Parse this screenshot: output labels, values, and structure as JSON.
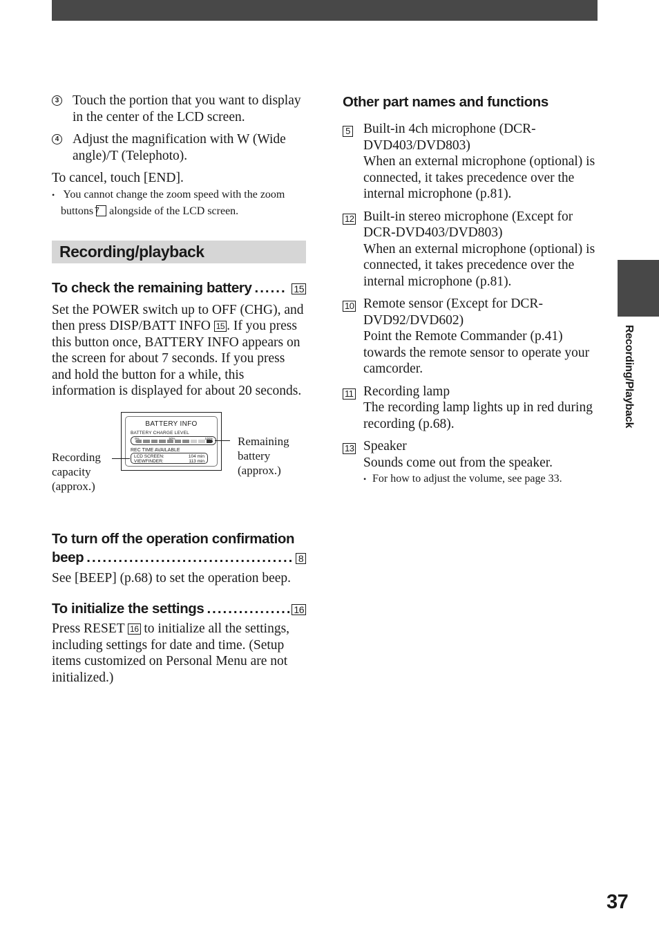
{
  "header": {
    "bar_color": "#484848"
  },
  "left": {
    "steps": [
      {
        "num": "3",
        "text": "Touch the portion that you want to display in the center of the LCD screen."
      },
      {
        "num": "4",
        "text": "Adjust the magnification with W (Wide angle)/T (Telephoto)."
      }
    ],
    "cancel_text": "To cancel, touch [END].",
    "note": {
      "before": "You cannot change the zoom speed with the zoom buttons",
      "ref": "7",
      "after": "alongside of the LCD screen."
    },
    "section_title": "Recording/playback",
    "battery": {
      "heading": "To check the remaining battery",
      "ref": "15",
      "body_1": "Set the POWER switch up to OFF (CHG), and then press DISP/BATT INFO",
      "body_ref": "15",
      "body_2": ". If you press this button once, BATTERY INFO appears on the screen for about 7 seconds. If you press and hold the button for a while, this information is displayed for about 20 seconds."
    },
    "diagram": {
      "title": "BATTERY INFO",
      "charge_label": "BATTERY CHARGE LEVEL",
      "ticks": [
        "0%",
        "50%",
        "100%"
      ],
      "charge_level": 0.7,
      "rec_label": "REC TIME AVAILABLE",
      "rows": [
        {
          "label": "LCD SCREEN:",
          "value": "104 min"
        },
        {
          "label": "VIEWFINDER:",
          "value": "113 min"
        }
      ],
      "callout_left": [
        "Recording",
        "capacity",
        "(approx.)"
      ],
      "callout_right": [
        "Remaining",
        "battery",
        "(approx.)"
      ]
    },
    "beep": {
      "heading_line1": "To turn off the operation confirmation",
      "heading_line2": "beep",
      "ref": "8",
      "body": "See [BEEP] (p.68) to set the operation beep."
    },
    "init": {
      "heading": "To initialize the settings",
      "ref": "16",
      "body_1": "Press RESET",
      "body_ref": "16",
      "body_2": "to initialize all the settings, including settings for date and time. (Setup items customized on Personal Menu are not initialized.)"
    }
  },
  "right": {
    "heading": "Other part names and functions",
    "items": [
      {
        "ref": "5",
        "title": "Built-in 4ch microphone (DCR-DVD403/DVD803)",
        "desc": "When an external microphone (optional) is connected, it takes precedence over the internal microphone (p.81)."
      },
      {
        "ref": "12",
        "title": "Built-in stereo microphone (Except for DCR-DVD403/DVD803)",
        "desc": "When an external microphone (optional) is connected, it takes precedence over the internal microphone (p.81)."
      },
      {
        "ref": "10",
        "title": "Remote sensor (Except for DCR-DVD92/DVD602)",
        "desc": "Point the Remote Commander (p.41) towards the remote sensor to operate your camcorder."
      },
      {
        "ref": "11",
        "title": "Recording lamp",
        "desc": "The recording lamp lights up in red during recording (p.68)."
      },
      {
        "ref": "13",
        "title": "Speaker",
        "desc": "Sounds come out from the speaker.",
        "note": "For how to adjust the volume, see page 33."
      }
    ]
  },
  "side_tab": {
    "label": "Recording/Playback"
  },
  "page_number": "37"
}
